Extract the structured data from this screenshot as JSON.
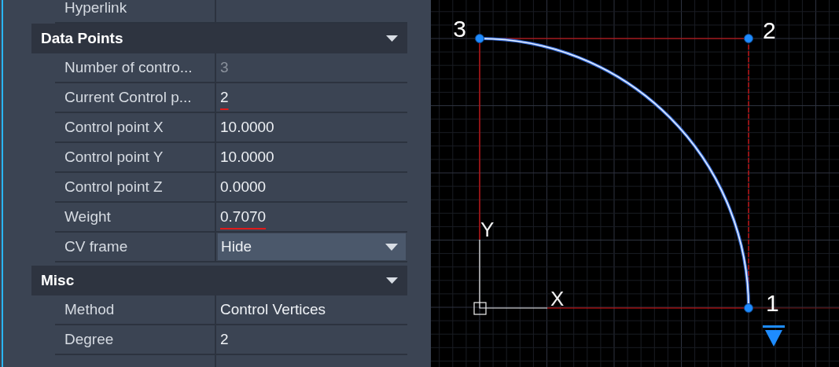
{
  "properties": {
    "top_rows": [
      {
        "label": "Hyperlink"
      }
    ],
    "sections": [
      {
        "title": "Data Points",
        "expanded": true,
        "rows": [
          {
            "label": "Number of contro...",
            "value": "3",
            "kind": "readonly"
          },
          {
            "label": "Current Control p...",
            "value": "2",
            "kind": "text",
            "annotated": true
          },
          {
            "label": "Control point X",
            "value": "10.0000",
            "kind": "text"
          },
          {
            "label": "Control point Y",
            "value": "10.0000",
            "kind": "text"
          },
          {
            "label": "Control point Z",
            "value": "0.0000",
            "kind": "text"
          },
          {
            "label": "Weight",
            "value": "0.7070",
            "kind": "text",
            "annotated": true
          },
          {
            "label": "CV frame",
            "value": "Hide",
            "kind": "dropdown"
          }
        ]
      },
      {
        "title": "Misc",
        "expanded": true,
        "rows": [
          {
            "label": "Method",
            "value": "Control Vertices",
            "kind": "text"
          },
          {
            "label": "Degree",
            "value": "2",
            "kind": "text"
          },
          {
            "kind": "text"
          }
        ]
      }
    ]
  },
  "canvas": {
    "control_points": [
      {
        "label": "3"
      },
      {
        "label": "2"
      },
      {
        "label": "1"
      }
    ],
    "ucs": {
      "x_label": "X",
      "y_label": "Y"
    }
  }
}
